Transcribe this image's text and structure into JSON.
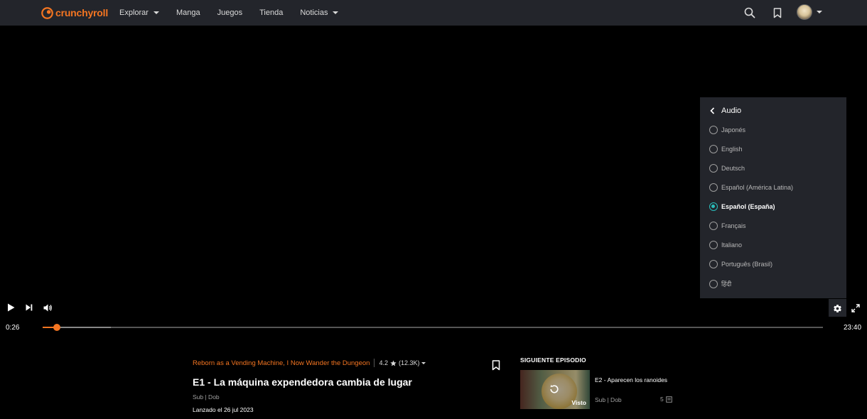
{
  "header": {
    "logo_text": "crunchyroll",
    "nav": [
      {
        "label": "Explorar",
        "dropdown": true
      },
      {
        "label": "Manga",
        "dropdown": false
      },
      {
        "label": "Juegos",
        "dropdown": false
      },
      {
        "label": "Tienda",
        "dropdown": false
      },
      {
        "label": "Noticias",
        "dropdown": true
      }
    ],
    "icons": [
      "search-icon",
      "bookmark-icon",
      "avatar",
      "chevron-down-icon"
    ]
  },
  "player": {
    "current_time": "0:26",
    "duration": "23:40",
    "progress_fraction": 0.0183,
    "buffered_fraction": 0.087,
    "controls": [
      "play-icon",
      "next-icon",
      "volume-icon",
      "gear-icon",
      "fullscreen-icon"
    ]
  },
  "audio_panel": {
    "title": "Audio",
    "options": [
      {
        "label": "Japonés",
        "selected": false
      },
      {
        "label": "English",
        "selected": false
      },
      {
        "label": "Deutsch",
        "selected": false
      },
      {
        "label": "Español (América Latina)",
        "selected": false
      },
      {
        "label": "Español (España)",
        "selected": true
      },
      {
        "label": "Français",
        "selected": false
      },
      {
        "label": "Italiano",
        "selected": false
      },
      {
        "label": "Português (Brasil)",
        "selected": false
      },
      {
        "label": "हिंदी",
        "selected": false
      }
    ]
  },
  "episode": {
    "series": "Reborn as a Vending Machine, I Now Wander the Dungeon",
    "rating": "4.2",
    "rating_count": "(12.3K)",
    "title": "E1 - La máquina expendedora cambia de lugar",
    "subdub": "Sub | Dob",
    "release": "Lanzado el 26 jul 2023"
  },
  "next_episode": {
    "heading": "SIGUIENTE EPISODIO",
    "title": "E2 - Aparecen los ranoides",
    "subdub": "Sub | Dob",
    "comments": "5",
    "watched_label": "Visto"
  },
  "colors": {
    "accent": "#f47521",
    "header_bg": "#23252b",
    "panel_bg": "#23252b",
    "radio_selected": "#2abdbb"
  }
}
